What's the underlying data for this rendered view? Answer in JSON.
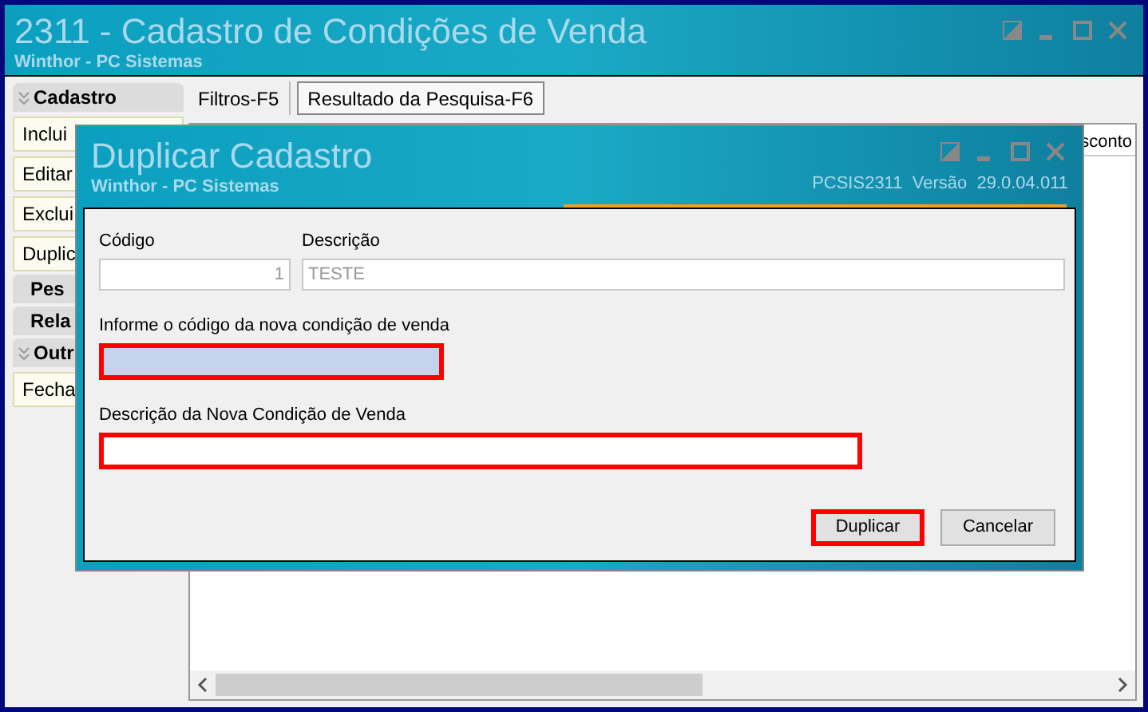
{
  "window": {
    "title": "2311 - Cadastro de Condições de Venda",
    "subtitle": "Winthor - PC Sistemas"
  },
  "sidebar": {
    "sections": [
      {
        "title": "Cadastro",
        "expanded": true,
        "items": [
          "Inclui",
          "Editar",
          "Exclui",
          "Duplic"
        ]
      },
      {
        "title": "Pes",
        "expanded": false
      },
      {
        "title": "Rela",
        "expanded": false
      },
      {
        "title": "Outr",
        "expanded": true,
        "items": [
          "Fecha"
        ]
      }
    ]
  },
  "tabs": [
    {
      "label": "Filtros-F5",
      "selected": false
    },
    {
      "label": "Resultado da Pesquisa-F6",
      "selected": true
    }
  ],
  "table": {
    "columns": [
      {
        "label": "sconto"
      }
    ]
  },
  "dialog": {
    "title": "Duplicar Cadastro",
    "subtitle": "Winthor - PC Sistemas",
    "version": "PCSIS2311  Versão  29.0.04.011",
    "fields": [
      {
        "label": "Código",
        "value": "1",
        "kind": "number",
        "disabled": true,
        "highlighted": false
      },
      {
        "label": "Descrição",
        "value": "TESTE",
        "kind": "text",
        "disabled": true,
        "highlighted": false
      },
      {
        "label": "Informe o código da nova condição de venda",
        "kind": "number",
        "disabled": false,
        "highlighted": true,
        "focused": true
      },
      {
        "label": "Descrição da Nova Condição de Venda",
        "kind": "text",
        "disabled": false,
        "highlighted": true,
        "focused": false
      }
    ],
    "buttons": [
      {
        "label": "Duplicar",
        "highlighted": true
      },
      {
        "label": "Cancelar",
        "highlighted": false
      }
    ]
  }
}
